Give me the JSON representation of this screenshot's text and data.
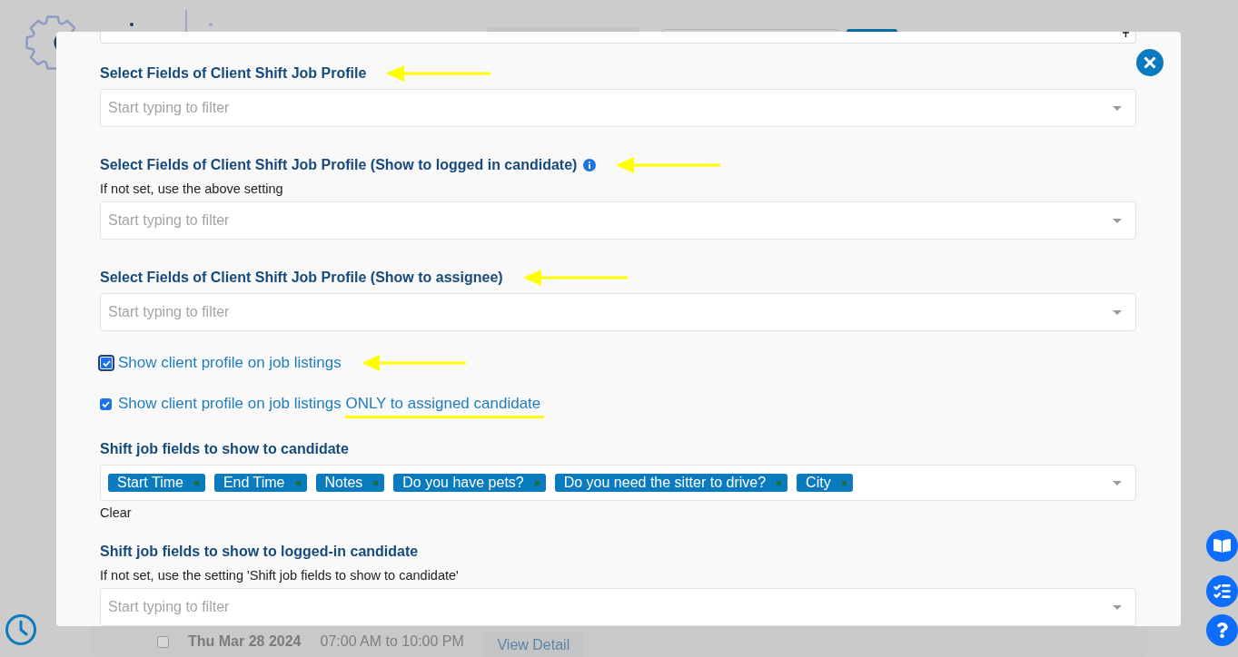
{
  "dialog": {
    "sections": [
      {
        "kind": "select",
        "title": "Select Fields of Client Shift Job Profile",
        "info": false,
        "pointer": true,
        "placeholder": "Start typing to filter"
      },
      {
        "kind": "select",
        "title": "Select Fields of Client Shift Job Profile (Show to logged in candidate)",
        "info": true,
        "pointer": true,
        "hint": "If not set, use the above setting",
        "placeholder": "Start typing to filter"
      },
      {
        "kind": "select",
        "title": "Select Fields of Client Shift Job Profile (Show to assignee)",
        "info": false,
        "pointer": true,
        "placeholder": "Start typing to filter"
      },
      {
        "kind": "checkbox",
        "checked": true,
        "focused": true,
        "pointer": true,
        "label": [
          {
            "text": "Show client profile on job listings",
            "underlined": false
          }
        ]
      },
      {
        "kind": "checkbox",
        "checked": true,
        "focused": false,
        "pointer": false,
        "label": [
          {
            "text": "Show client profile on job listings",
            "underlined": false
          },
          {
            "text": "ONLY to assigned candidate",
            "underlined": true
          }
        ]
      },
      {
        "kind": "tags",
        "title": "Shift job fields to show to candidate",
        "info": false,
        "pointer": false,
        "tags": [
          "Start Time",
          "End Time",
          "Notes",
          "Do you have pets?",
          "Do you need the sitter to drive?",
          "City"
        ],
        "clear": "Clear"
      },
      {
        "kind": "select",
        "title": "Shift job fields to show to logged-in candidate",
        "info": false,
        "pointer": false,
        "hint": "If not set, use the setting 'Shift job fields to show to candidate'",
        "placeholder": "Start typing to filter"
      }
    ]
  },
  "schedule_row": {
    "checked": false,
    "date": "Thu Mar 28 2024",
    "time": "07:00 AM to 10:00 PM",
    "action": "View Detail"
  }
}
